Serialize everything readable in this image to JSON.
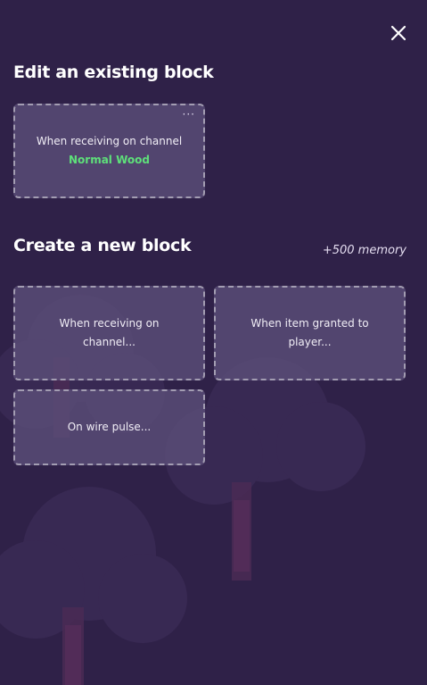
{
  "edit_section": {
    "title": "Edit an existing block",
    "block": {
      "trigger_label": "When receiving on channel",
      "channel_name": "Normal Wood",
      "menu_icon": "more-horizontal-icon",
      "menu_glyph": "···"
    }
  },
  "create_section": {
    "title": "Create a new block",
    "memory_cost": "+500 memory",
    "options": [
      {
        "label": "When receiving on channel..."
      },
      {
        "label": "When item granted to player..."
      },
      {
        "label": "On wire pulse..."
      }
    ]
  },
  "close_icon": "close-icon",
  "colors": {
    "background": "#2f2148",
    "card_background": "#5c507a",
    "card_border": "#a39db2",
    "channel_highlight": "#5ee07a"
  }
}
